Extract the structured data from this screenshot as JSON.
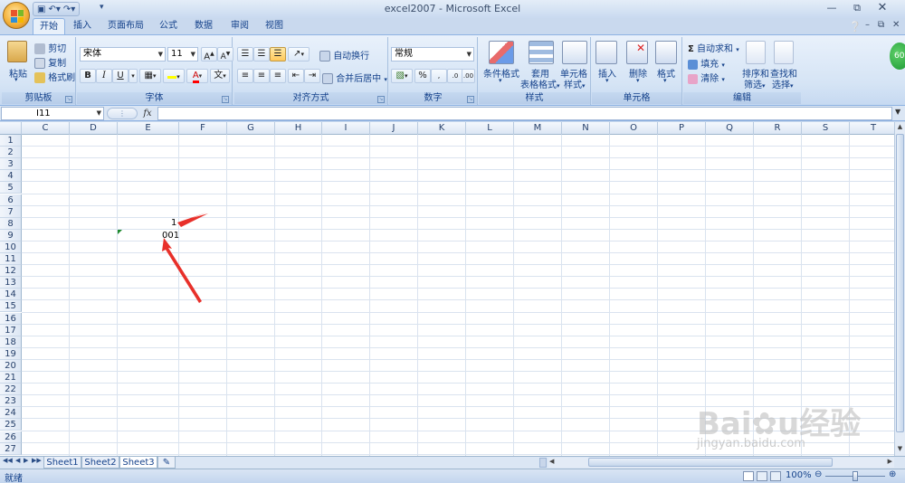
{
  "window": {
    "title": "excel2007 - Microsoft Excel"
  },
  "tabs": [
    "开始",
    "插入",
    "页面布局",
    "公式",
    "数据",
    "审阅",
    "视图"
  ],
  "clipboard": {
    "paste": "粘贴",
    "cut": "剪切",
    "copy": "复制",
    "format_painter": "格式刷",
    "label": "剪贴板"
  },
  "font": {
    "name": "宋体",
    "size": "11",
    "bold": "B",
    "italic": "I",
    "underline": "U",
    "label": "字体"
  },
  "alignment": {
    "wrap_text": "自动换行",
    "merge_center": "合并后居中",
    "label": "对齐方式"
  },
  "number": {
    "format": "常规",
    "percent": "%",
    "label": "数字"
  },
  "styles": {
    "conditional": "条件格式",
    "table_format_1": "套用",
    "table_format_2": "表格格式",
    "cell_styles_1": "单元格",
    "cell_styles_2": "样式",
    "label": "样式"
  },
  "cells": {
    "insert": "插入",
    "delete": "删除",
    "format": "格式",
    "label": "单元格"
  },
  "editing": {
    "autosum": "自动求和",
    "fill": "填充",
    "clear": "清除",
    "sort_1": "排序和",
    "sort_2": "筛选",
    "find_1": "查找和",
    "find_2": "选择",
    "label": "编辑"
  },
  "formula_bar": {
    "name_box": "I11",
    "fx": "fx"
  },
  "columns": [
    "C",
    "D",
    "E",
    "F",
    "G",
    "H",
    "I",
    "J",
    "K",
    "L",
    "M",
    "N",
    "O",
    "P",
    "Q",
    "R",
    "S",
    "T"
  ],
  "rows": [
    "1",
    "2",
    "3",
    "4",
    "5",
    "6",
    "7",
    "8",
    "9",
    "10",
    "11",
    "12",
    "13",
    "14",
    "15",
    "16",
    "17",
    "18",
    "19",
    "20",
    "21",
    "22",
    "23",
    "24",
    "25",
    "26",
    "27"
  ],
  "cell_values": {
    "E8": "1",
    "E9": "001"
  },
  "sheets": [
    "Sheet1",
    "Sheet2",
    "Sheet3"
  ],
  "status": {
    "ready": "就绪",
    "zoom": "100%"
  },
  "badge": "60",
  "watermark": "Baidu经验 jingyan.baidu.com"
}
